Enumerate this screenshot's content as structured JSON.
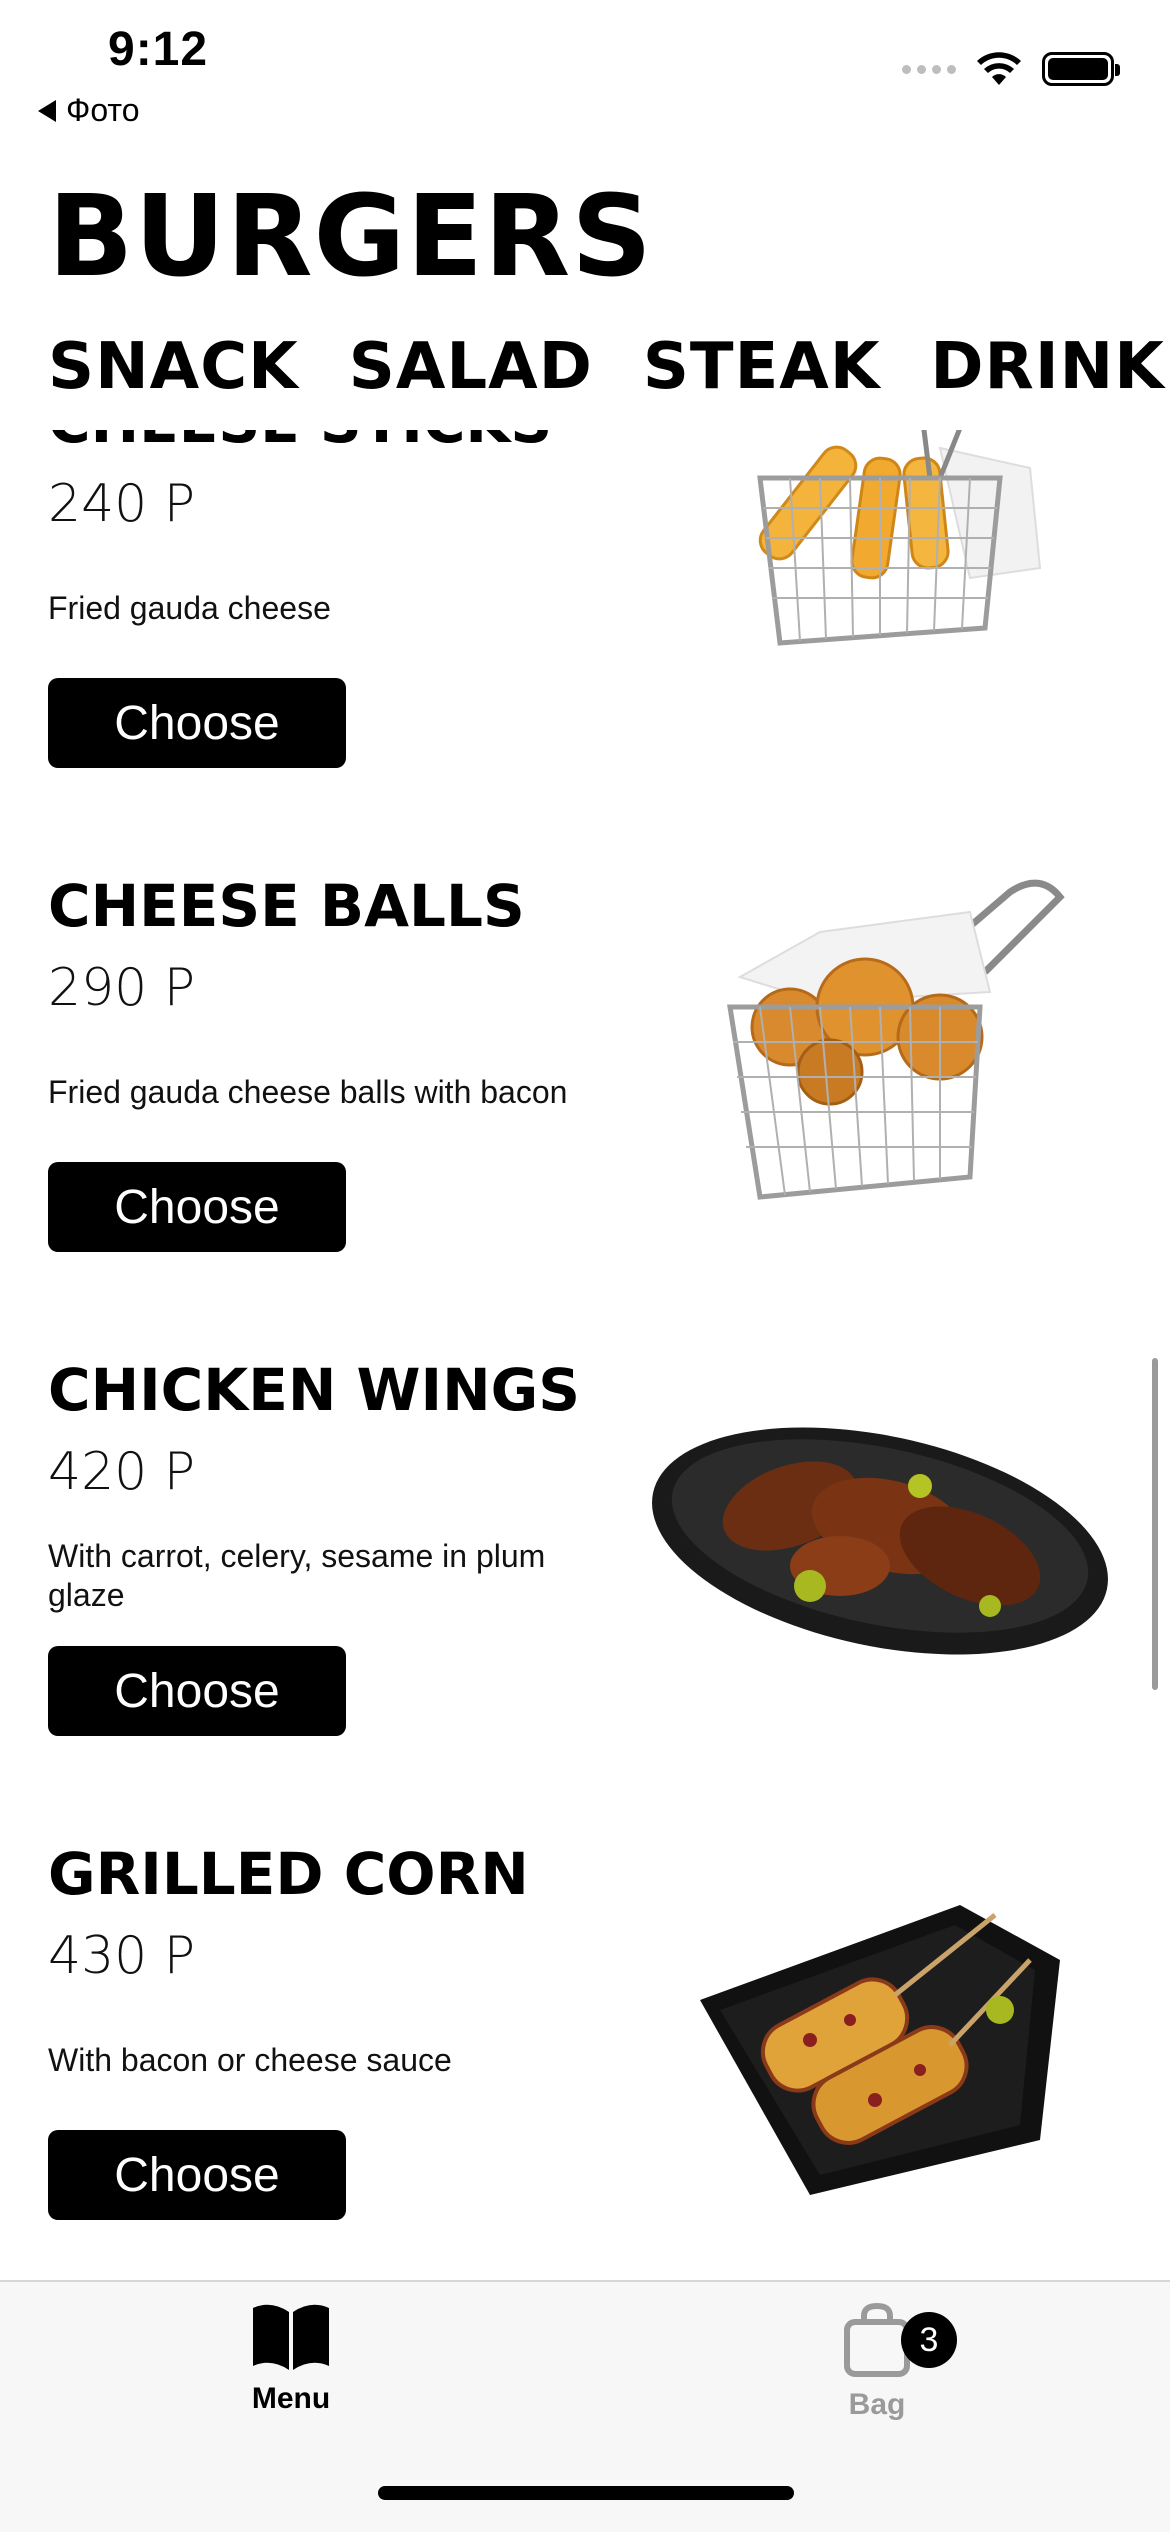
{
  "status_bar": {
    "time": "9:12",
    "back_app": "Фото"
  },
  "title": "BURGERS",
  "categories": [
    "SNACK",
    "SALAD",
    "STEAK",
    "DRINK"
  ],
  "items": [
    {
      "name": "CHEESE STICKS",
      "price": "240 Р",
      "description": "Fried gauda cheese",
      "button": "Choose"
    },
    {
      "name": "CHEESE BALLS",
      "price": "290 Р",
      "description": "Fried gauda cheese balls with bacon",
      "button": "Choose"
    },
    {
      "name": "CHICKEN WINGS",
      "price": "420 Р",
      "description": "With carrot, celery, sesame in plum glaze",
      "button": "Choose"
    },
    {
      "name": "GRILLED CORN",
      "price": "430 Р",
      "description": "With bacon or cheese sauce",
      "button": "Choose"
    }
  ],
  "tab_bar": {
    "menu_label": "Menu",
    "bag_label": "Bag",
    "bag_count": "3"
  },
  "colors": {
    "accent": "#000000",
    "inactive": "#9a9a9a",
    "tabbar_bg": "#f7f7f7"
  },
  "icons": [
    "back-triangle-icon",
    "signal-icon",
    "wifi-icon",
    "battery-icon",
    "book-icon",
    "bag-icon"
  ]
}
